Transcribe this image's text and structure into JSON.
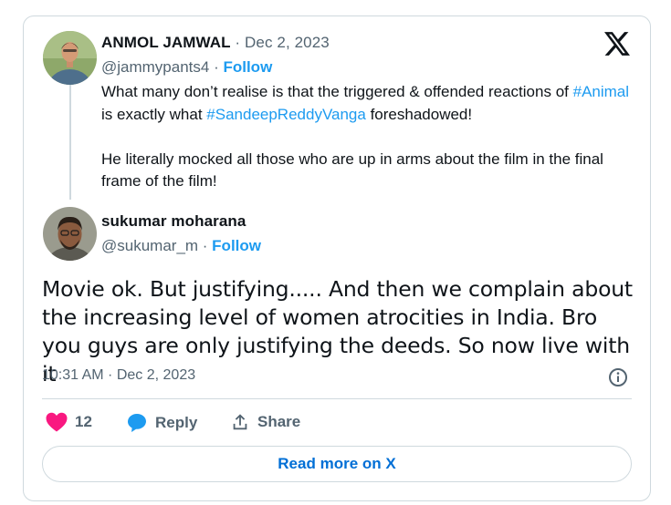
{
  "parent": {
    "name": "ANMOL JAMWAL",
    "date": "Dec 2, 2023",
    "handle": "@jammypants4",
    "follow_label": "Follow",
    "text_1a": "What many don’t realise is that the triggered & offended reactions of",
    "hashtag_1": "#Animal",
    "text_1b": "is exactly what",
    "hashtag_2": "#SandeepReddyVanga",
    "text_1c": "foreshadowed!",
    "text_2": "He literally mocked all those who are up in arms about the film in the final frame of the film!"
  },
  "reply": {
    "name": "sukumar moharana",
    "handle": "@sukumar_m",
    "follow_label": "Follow",
    "text": "Movie ok. But justifying..... And then we complain about the increasing level of women atrocities in India. Bro you guys are only justifying the deeds. So now live with it",
    "time": "10:31 AM",
    "date": "Dec 2, 2023"
  },
  "actions": {
    "like_count": "12",
    "reply_label": "Reply",
    "share_label": "Share"
  },
  "read_more_label": "Read more on X",
  "icons": {
    "like": "heart-icon",
    "reply": "speech-bubble-icon",
    "share": "share-arrow-icon",
    "info": "info-icon",
    "logo": "x-logo-icon"
  },
  "colors": {
    "link": "#1d9bf0",
    "like": "#f91880",
    "border": "#cfd9de",
    "muted": "#536471"
  }
}
